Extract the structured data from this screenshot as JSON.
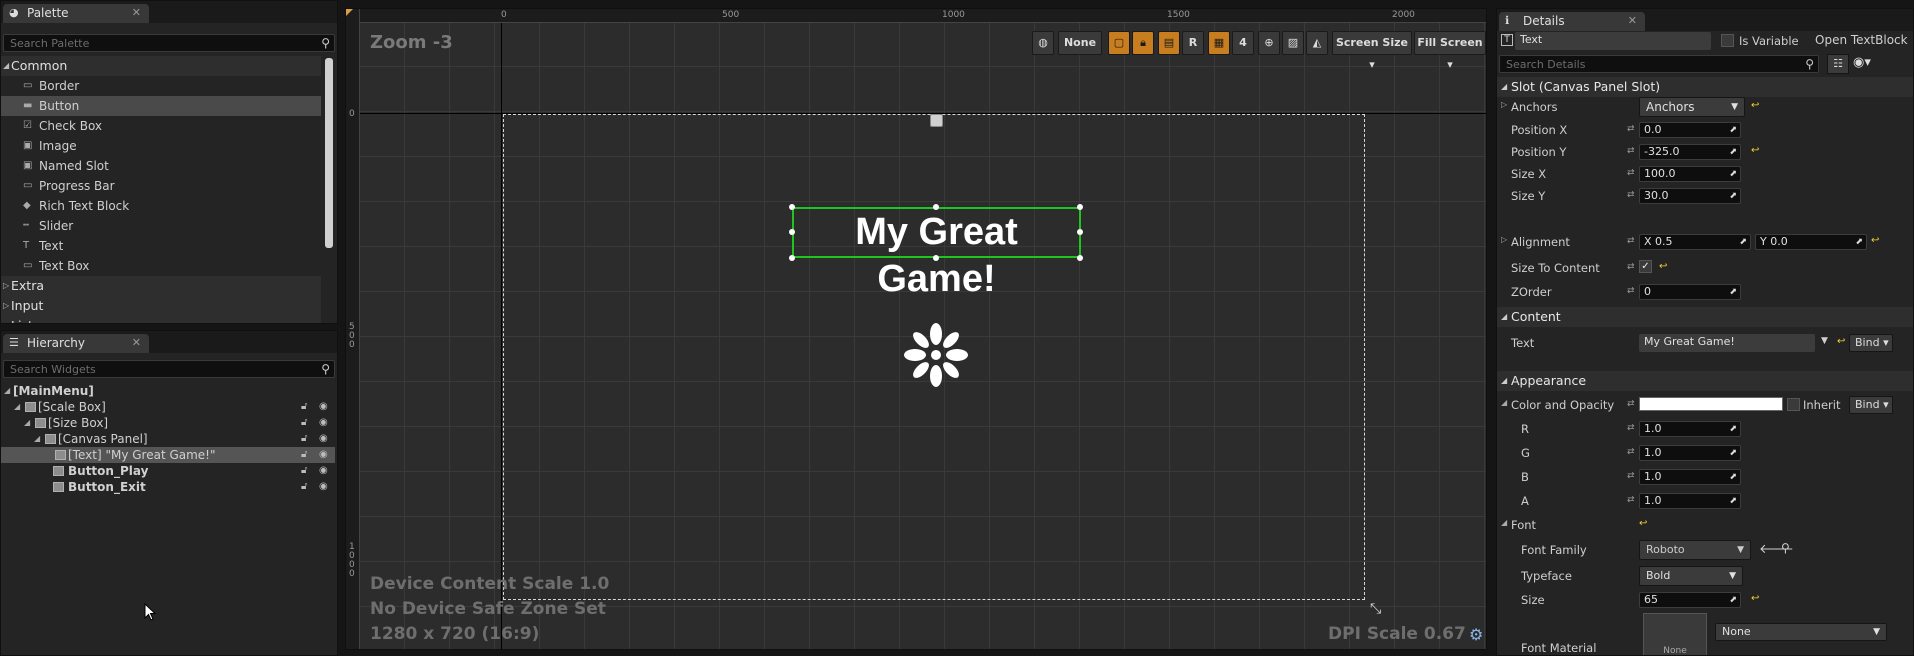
{
  "palette": {
    "tab_label": "Palette",
    "search_placeholder": "Search Palette",
    "categories": {
      "common": "Common",
      "extra": "Extra",
      "input": "Input",
      "lists": "Lists"
    },
    "items": [
      "Border",
      "Button",
      "Check Box",
      "Image",
      "Named Slot",
      "Progress Bar",
      "Rich Text Block",
      "Slider",
      "Text",
      "Text Box"
    ],
    "selected_item": "Button"
  },
  "hierarchy": {
    "tab_label": "Hierarchy",
    "search_placeholder": "Search Widgets",
    "rows": [
      "[MainMenu]",
      "[Scale Box]",
      "[Size Box]",
      "[Canvas Panel]",
      "[Text] \"My Great Game!\"",
      "Button_Play",
      "Button_Exit"
    ],
    "selected_row": "[Text] \"My Great Game!\""
  },
  "designer": {
    "zoom": "Zoom -3",
    "ruler_top": [
      "0",
      "500",
      "1000",
      "1500",
      "2000"
    ],
    "ruler_left": [
      "0",
      "500",
      "1000"
    ],
    "toolbar": {
      "none": "None",
      "r": "R",
      "four": "4",
      "screen_size": "Screen Size",
      "fill_screen": "Fill Screen"
    },
    "title_text": "My Great Game!",
    "device_content_scale": "Device Content Scale 1.0",
    "safe_zone": "No Device Safe Zone Set",
    "resolution": "1280 x 720 (16:9)",
    "dpi_scale": "DPI Scale 0.67"
  },
  "details": {
    "tab_label": "Details",
    "name_value": "Text",
    "is_variable": "Is Variable",
    "open_textblock": "Open TextBlock",
    "search_placeholder": "Search Details",
    "slot_section": "Slot (Canvas Panel Slot)",
    "anchors_label": "Anchors",
    "anchors_value": "Anchors",
    "position_x_label": "Position X",
    "position_x": "0.0",
    "position_y_label": "Position Y",
    "position_y": "-325.0",
    "size_x_label": "Size X",
    "size_x": "100.0",
    "size_y_label": "Size Y",
    "size_y": "30.0",
    "alignment_label": "Alignment",
    "alignment_x": "X  0.5",
    "alignment_y": "Y  0.0",
    "size_to_content_label": "Size To Content",
    "zorder_label": "ZOrder",
    "zorder": "0",
    "content_section": "Content",
    "text_label": "Text",
    "text_value": "My Great Game!",
    "bind": "Bind",
    "appearance_section": "Appearance",
    "color_label": "Color and Opacity",
    "inherit": "Inherit",
    "r_label": "R",
    "r": "1.0",
    "g_label": "G",
    "g": "1.0",
    "b_label": "B",
    "b": "1.0",
    "a_label": "A",
    "a": "1.0",
    "font_label": "Font",
    "font_family_label": "Font Family",
    "font_family": "Roboto",
    "typeface_label": "Typeface",
    "typeface": "Bold",
    "size_label": "Size",
    "size": "65",
    "font_material_label": "Font Material",
    "font_material_thumb": "None",
    "font_material": "None"
  },
  "colors": {
    "selection_outline": "#1fc41f",
    "accent_orange": "#c87d1e",
    "reset_yellow": "#f0d030"
  }
}
